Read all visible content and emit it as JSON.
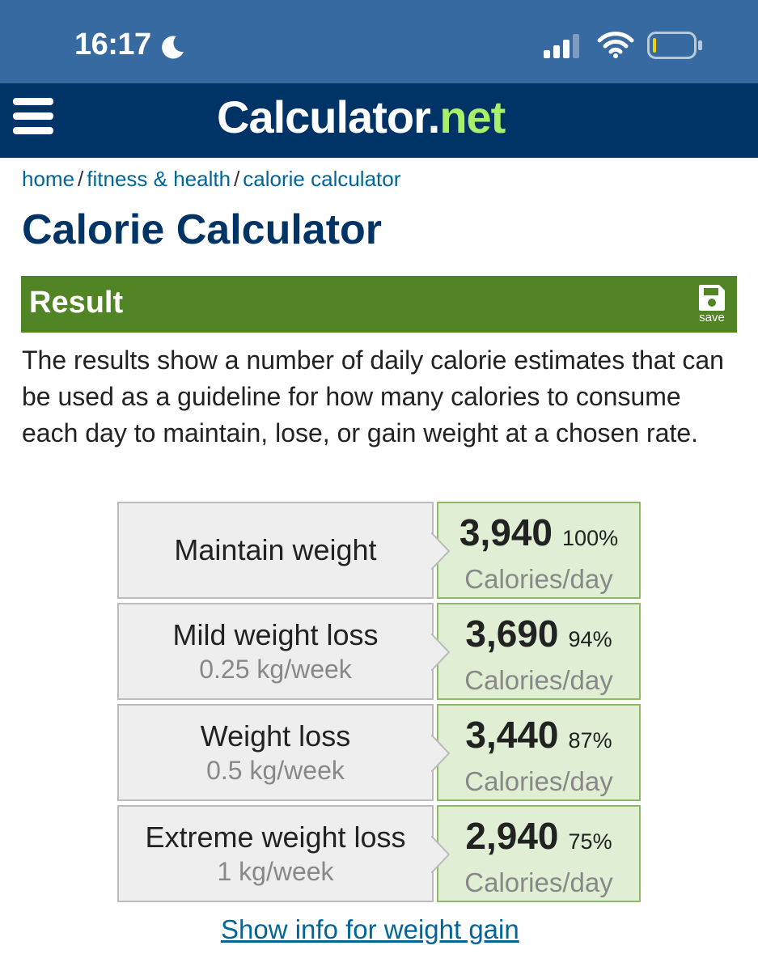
{
  "status_bar": {
    "time": "16:17",
    "icons": [
      "moon-icon",
      "cellular-signal-icon",
      "wifi-icon",
      "battery-icon"
    ]
  },
  "header": {
    "logo_main": "Calculator",
    "logo_dot": ".",
    "logo_net": "net",
    "menu_icon": "hamburger-menu-icon",
    "colors": {
      "header_bg": "#003366",
      "status_bg": "#366aa0",
      "logo_accent": "#a8f06a"
    }
  },
  "breadcrumb": {
    "items": [
      "home",
      "fitness & health",
      "calorie calculator"
    ],
    "separator": "/"
  },
  "page": {
    "title": "Calorie Calculator"
  },
  "result": {
    "heading": "Result",
    "save_label": "save",
    "save_icon": "floppy-disk-icon",
    "bar_color": "#518424",
    "intro": "The results show a number of daily calorie estimates that can be used as a guideline for how many calories to consume each day to maintain, lose, or gain weight at a chosen rate.",
    "unit": "Calories/day",
    "rows": [
      {
        "label": "Maintain weight",
        "sub": "",
        "calories": "3,940",
        "percent": "100%"
      },
      {
        "label": "Mild weight loss",
        "sub": "0.25 kg/week",
        "calories": "3,690",
        "percent": "94%"
      },
      {
        "label": "Weight loss",
        "sub": "0.5 kg/week",
        "calories": "3,440",
        "percent": "87%"
      },
      {
        "label": "Extreme weight loss",
        "sub": "1 kg/week",
        "calories": "2,940",
        "percent": "75%"
      }
    ],
    "gain_link": "Show info for weight gain"
  }
}
